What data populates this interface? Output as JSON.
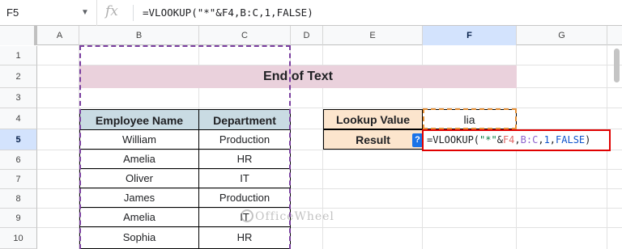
{
  "formula_bar": {
    "name_box": "F5",
    "fx_symbol": "fx",
    "formula": "=VLOOKUP(\"*\"&F4,B:C,1,FALSE)"
  },
  "columns": [
    "A",
    "B",
    "C",
    "D",
    "E",
    "F",
    "G"
  ],
  "active_column": "F",
  "rows": [
    "1",
    "2",
    "3",
    "4",
    "5",
    "6",
    "7",
    "8",
    "9",
    "10"
  ],
  "active_row": "5",
  "title": "End of Text",
  "table": {
    "headers": [
      "Employee Name",
      "Department"
    ],
    "rows": [
      [
        "William",
        "Production"
      ],
      [
        "Amelia",
        "HR"
      ],
      [
        "Oliver",
        "IT"
      ],
      [
        "James",
        "Production"
      ],
      [
        "Amelia",
        "IT"
      ],
      [
        "Sophia",
        "HR"
      ]
    ]
  },
  "lookup": {
    "label": "Lookup Value",
    "value": "lia",
    "result_label": "Result",
    "help_icon": "?"
  },
  "editor": {
    "tokens": {
      "prefix": "=VLOOKUP(",
      "str": "\"*\"",
      "amp": "&",
      "ref": "F4",
      "comma1": ",",
      "rng": "B:C",
      "comma2": ",",
      "num": "1",
      "comma3": ",",
      "kw": "FALSE",
      "suffix": ")"
    }
  },
  "watermark": "OfficeWheel",
  "colors": {
    "title_bg": "#ead1dc",
    "header_bg": "#c9dbe3",
    "lookup_bg": "#fce5cd",
    "active_header": "#d3e3fd",
    "edit_border": "#e00000"
  }
}
